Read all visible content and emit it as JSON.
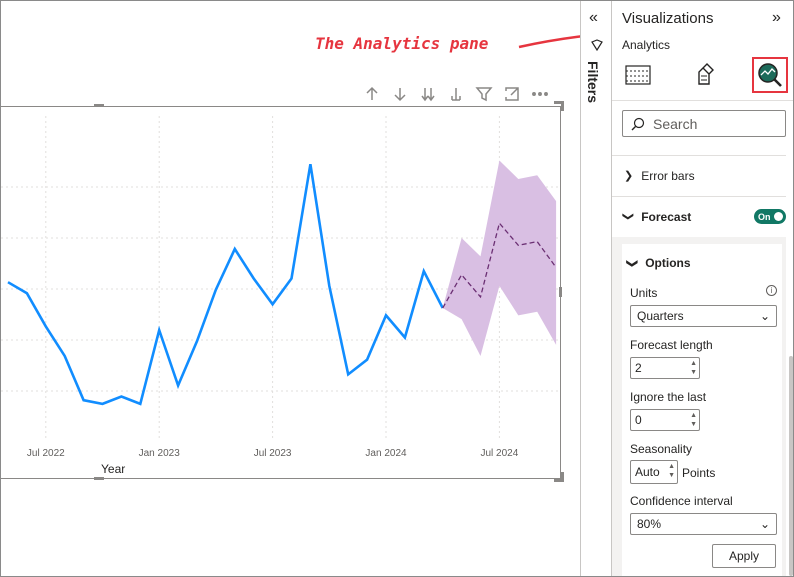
{
  "annotation": {
    "text": "The Analytics pane"
  },
  "visual_toolbar": {
    "icons": [
      "arrow-up-icon",
      "arrow-down-icon",
      "double-arrow-down-icon",
      "expand-hierarchy-icon",
      "filter-icon",
      "focus-mode-icon",
      "more-options-icon"
    ]
  },
  "chart_data": {
    "type": "line",
    "xlabel": "Year",
    "x_tick_labels": [
      "Jul 2022",
      "Jan 2023",
      "Jul 2023",
      "Jan 2024",
      "Jul 2024"
    ],
    "x_tick_index": [
      2,
      8,
      14,
      20,
      26
    ],
    "series": [
      {
        "values": [
          79,
          76,
          67,
          59,
          47,
          46,
          48,
          46,
          66,
          51,
          63,
          77,
          88,
          80,
          73,
          80,
          111,
          78,
          54,
          58,
          70,
          64,
          82,
          72
        ]
      }
    ],
    "forecast": {
      "start_index": 23,
      "values": [
        72,
        81,
        75,
        95,
        89,
        90,
        83
      ],
      "upper": [
        72,
        91,
        86,
        112,
        107,
        108,
        101
      ],
      "lower": [
        72,
        69,
        59,
        78,
        70,
        71,
        62
      ]
    },
    "colors": {
      "line": "#118dff",
      "forecast": "#6b2f73",
      "band": "#d9bfe3"
    },
    "grid": true
  },
  "filters": {
    "label": "Filters"
  },
  "visualizations": {
    "title": "Visualizations",
    "subtitle": "Analytics",
    "tabs": [
      "build-visual-icon",
      "format-visual-icon",
      "analytics-icon"
    ],
    "search_placeholder": "Search",
    "sections": {
      "error_bars": "Error bars",
      "forecast": "Forecast",
      "forecast_toggle": "On"
    },
    "options": {
      "title": "Options",
      "units_label": "Units",
      "units_value": "Quarters",
      "forecast_length_label": "Forecast length",
      "forecast_length_value": "2",
      "ignore_last_label": "Ignore the last",
      "ignore_last_value": "0",
      "seasonality_label": "Seasonality",
      "seasonality_value": "Auto",
      "seasonality_unit": "Points",
      "confidence_label": "Confidence interval",
      "confidence_value": "80%",
      "apply_label": "Apply"
    }
  },
  "accent": "#117865",
  "highlight": "#e6353f"
}
